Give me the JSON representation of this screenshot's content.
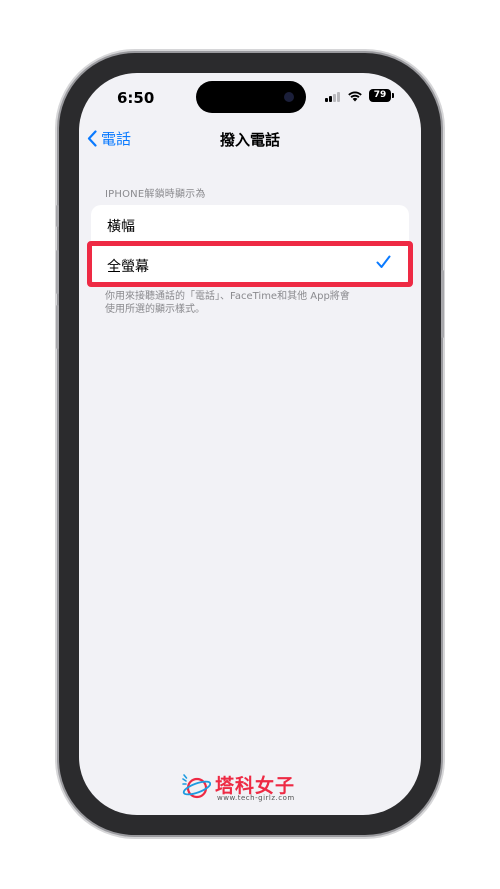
{
  "status_bar": {
    "time": "6:50",
    "battery": "79"
  },
  "nav": {
    "back_label": "電話",
    "title": "撥入電話"
  },
  "section": {
    "header": "IPHONE解鎖時顯示為",
    "options": [
      {
        "label": "橫幅",
        "selected": false
      },
      {
        "label": "全螢幕",
        "selected": true
      }
    ],
    "footer": [
      "你用來接聽通話的「電話」、FaceTime和其他 App將會",
      "使用所選的顯示樣式。"
    ]
  },
  "watermark": {
    "title": "塔科女子",
    "url": "www.tech-girlz.com"
  },
  "colors": {
    "accent": "#0a7aff",
    "highlight": "#ee2a44",
    "background": "#f2f2f6"
  }
}
